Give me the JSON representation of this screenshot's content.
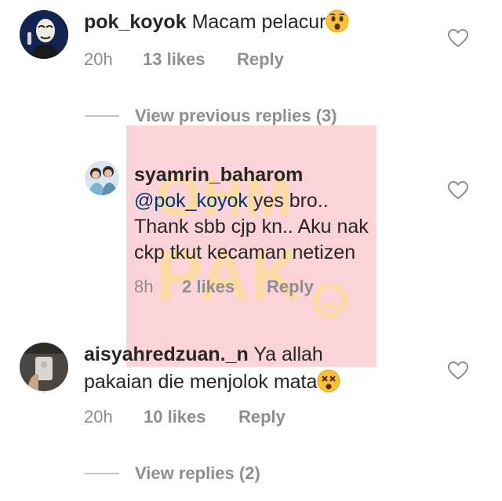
{
  "comments": [
    {
      "username": "pok_koyok",
      "text": "Macam pelacur",
      "emoji": "astonished-face-emoji",
      "time": "20h",
      "likes": "13 likes",
      "reply": "Reply"
    },
    {
      "username": "aisyahredzuan._n",
      "text_line1": "Ya allah",
      "text_line2": "pakaian die menjolok mata",
      "emoji": "dizzy-face-emoji",
      "time": "20h",
      "likes": "10 likes",
      "reply": "Reply"
    }
  ],
  "view_previous": "View previous replies (3)",
  "reply_comment": {
    "username": "syamrin_baharom",
    "mention": "@pok_koyok",
    "text_line1": " yes bro..",
    "text_line2": "Thank sbb cjp kn.. Aku nak",
    "text_line3": "ckp tkut kecaman netizen",
    "time": "8h",
    "likes": "2 likes",
    "reply": "Reply"
  },
  "view_replies": "View replies (2)",
  "watermark": {
    "line1": "OHM",
    "line2": "PAK"
  },
  "colors": {
    "text": "#262626",
    "meta": "#8e8e8e",
    "mention": "#003569"
  }
}
